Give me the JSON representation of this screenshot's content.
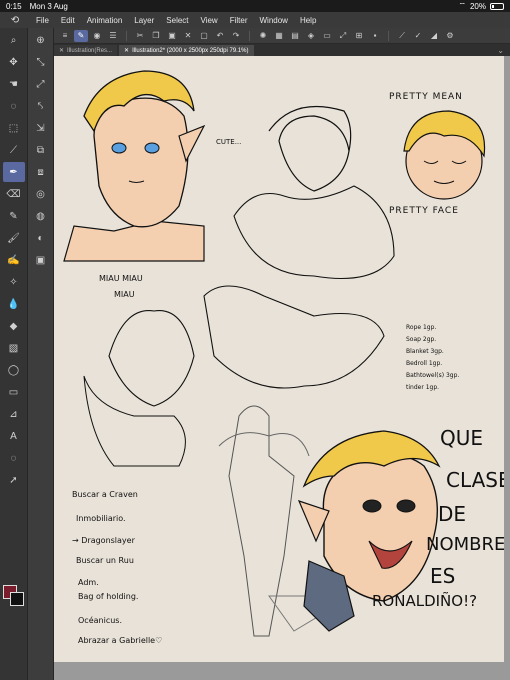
{
  "status": {
    "time": "0:15",
    "date": "Mon 3 Aug",
    "battery": "20%"
  },
  "menu": [
    "File",
    "Edit",
    "Animation",
    "Layer",
    "Select",
    "View",
    "Filter",
    "Window",
    "Help"
  ],
  "tabs": [
    {
      "label": "Illustration(Res..."
    },
    {
      "label": "Illustration2* (2000 x 2500px 250dpi 79.1%)"
    }
  ],
  "tool_icons": [
    "menu-icon",
    "pen-icon",
    "eye-icon",
    "list-icon"
  ],
  "sidebar_tools": [
    "zoom-icon",
    "move-icon",
    "hand-icon",
    "lasso-icon",
    "select-icon",
    "eyedropper-icon",
    "pen-icon",
    "eraser-icon",
    "pencil-icon",
    "paint-icon",
    "brush-icon",
    "airbrush-icon",
    "blend-icon",
    "fill-icon",
    "gradient-icon",
    "rect-icon",
    "ellipse-icon",
    "crop-icon",
    "text-icon",
    "balloon-icon",
    "pointer-icon"
  ],
  "colors": {
    "main": "#7a1e2e",
    "sub": "#111111"
  },
  "canvas_text": {
    "cute": "CUTE...",
    "pretty_mean": "PRETTY MEAN",
    "pretty_face": "PRETTY FACE",
    "miau": "MIAU MIAU",
    "miau2": "MIAU",
    "list": [
      "Rope 1gp.",
      "Soap 2gp.",
      "Blanket 3gp.",
      "Bedroll 1gp.",
      "Bathtowel(s) 3gp.",
      "tinder 1gp."
    ],
    "buscar": "Buscar a Craven",
    "incluye1": "Inmobiliario.",
    "incluye2": "→ Dragonslayer",
    "buscar2": "Buscar un Ruu",
    "notes": [
      "Adm.",
      "Bag of holding.",
      "Océanicus.",
      "Abrazar a Gabrielle♡"
    ],
    "que": "QUE",
    "clase": "CLASE",
    "de": "DE",
    "nombre": "NOMBRE",
    "es": "ES",
    "ronaldino": "RONALDIÑO!?"
  }
}
